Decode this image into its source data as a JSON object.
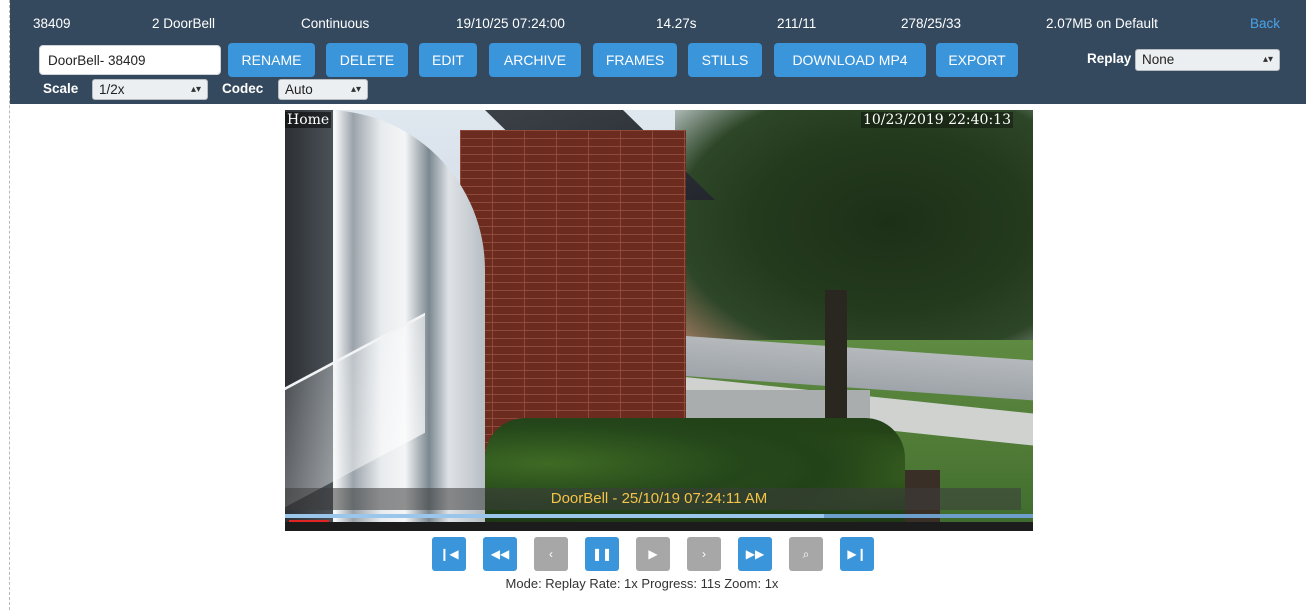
{
  "header": {
    "camera_id": "38409",
    "camera_name": "2 DoorBell",
    "record_type": "Continuous",
    "start_time": "19/10/25 07:24:00",
    "duration": "14.27s",
    "stat_a": "211/11",
    "stat_b": "278/25/33",
    "size": "2.07MB on Default",
    "back_label": "Back"
  },
  "toolbar": {
    "name_value": "DoorBell- 38409",
    "rename": "RENAME",
    "delete": "DELETE",
    "edit": "EDIT",
    "archive": "ARCHIVE",
    "frames": "FRAMES",
    "stills": "STILLS",
    "download_mp4": "DOWNLOAD MP4",
    "export": "EXPORT",
    "replay_label": "Replay",
    "replay_value": "None",
    "scale_label": "Scale",
    "scale_value": "1/2x",
    "codec_label": "Codec",
    "codec_value": "Auto"
  },
  "video": {
    "osd_camera": "Home",
    "osd_datetime": "10/23/2019 22:40:13",
    "caption": "DoorBell - 25/10/19 07:24:11 AM",
    "progress_fraction": 0.72
  },
  "controls": {
    "icons": [
      "skip-to-start-icon",
      "rewind-icon",
      "step-back-icon",
      "pause-icon",
      "play-icon",
      "step-forward-icon",
      "fast-forward-icon",
      "zoom-icon",
      "skip-to-end-icon"
    ]
  },
  "status": {
    "text": "Mode: Replay   Rate: 1x   Progress: 11s   Zoom: 1x"
  },
  "colors": {
    "header_bg": "#35495e",
    "button_blue": "#3b95db",
    "button_disabled": "#a7a7a7",
    "link_blue": "#4aa3e6",
    "caption_yellow": "#f3c34a"
  }
}
